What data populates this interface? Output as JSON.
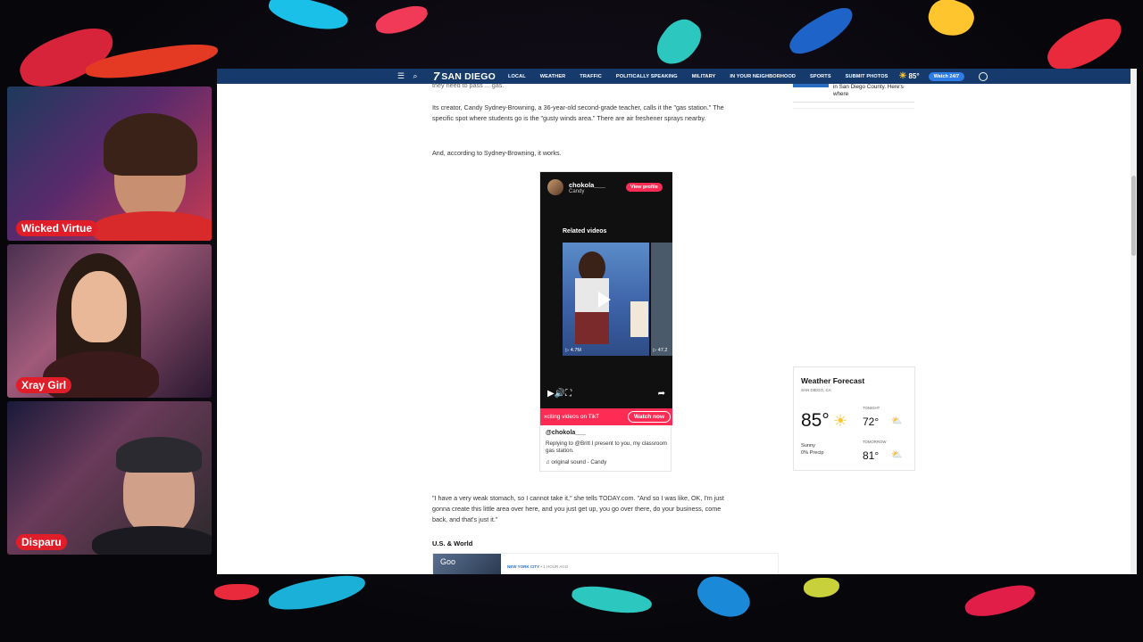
{
  "streamers": [
    {
      "name": "Wicked Virtue"
    },
    {
      "name": "Xray Girl"
    },
    {
      "name": "Disparu"
    }
  ],
  "site": {
    "brand_number": "7",
    "brand_city": "SAN DIEGO",
    "menu_icon": "hamburger-icon",
    "search_icon": "search-icon",
    "nav": [
      "LOCAL",
      "WEATHER",
      "TRAFFIC",
      "POLITICALLY SPEAKING",
      "MILITARY",
      "IN YOUR NEIGHBORHOOD",
      "SPORTS",
      "SUBMIT PHOTOS"
    ],
    "temp": "85°",
    "watch": "Watch 24/7",
    "colors": {
      "nav_bg": "#153a6b",
      "tiktok_red": "#fe2c55",
      "watch_blue": "#2e7de6"
    }
  },
  "article": {
    "cut_line": "they need to pass ... gas.",
    "p1": "Its creator, Candy Sydney-Browning, a 36-year-old second-grade teacher, calls it the \"gas station.\" The specific spot where students go is the \"gusty winds area.\" There are air freshener sprays nearby.",
    "p2": "And, according to Sydney-Browning, it works.",
    "p3": "\"I have a very weak stomach, so I cannot take it,\" she tells TODAY.com. \"And so I was like, OK, I'm just gonna create this little area over here, and you just get up, you go over there, do your business, come back, and that's just it.\"",
    "section": "U.S. & World",
    "card_tag": "NEW YORK CITY",
    "card_time": "• 1 HOUR AGO",
    "card_img_text": "Goo"
  },
  "tiktok": {
    "username": "chokola___",
    "display_name": "Candy",
    "view_profile": "View profile",
    "related": "Related videos",
    "views1": "▷ 4.7M",
    "views2": "▷ 47.2",
    "marquee": "xciting videos on TikT",
    "watch_now": "Watch now",
    "handle": "@chokola___",
    "caption": "Replying to @Britt  I present to you, my classroom gas station.",
    "sound": "original sound - Candy"
  },
  "sidebar": {
    "story_text": "in San Diego County. Here's where"
  },
  "weather": {
    "title": "Weather Forecast",
    "location": "SAN DIEGO, CA",
    "current": "85°",
    "condition": "Sunny",
    "precip": "0% Precip",
    "tonight_label": "TONIGHT",
    "tonight": "72°",
    "tomorrow_label": "TOMORROW",
    "tomorrow": "81°"
  }
}
